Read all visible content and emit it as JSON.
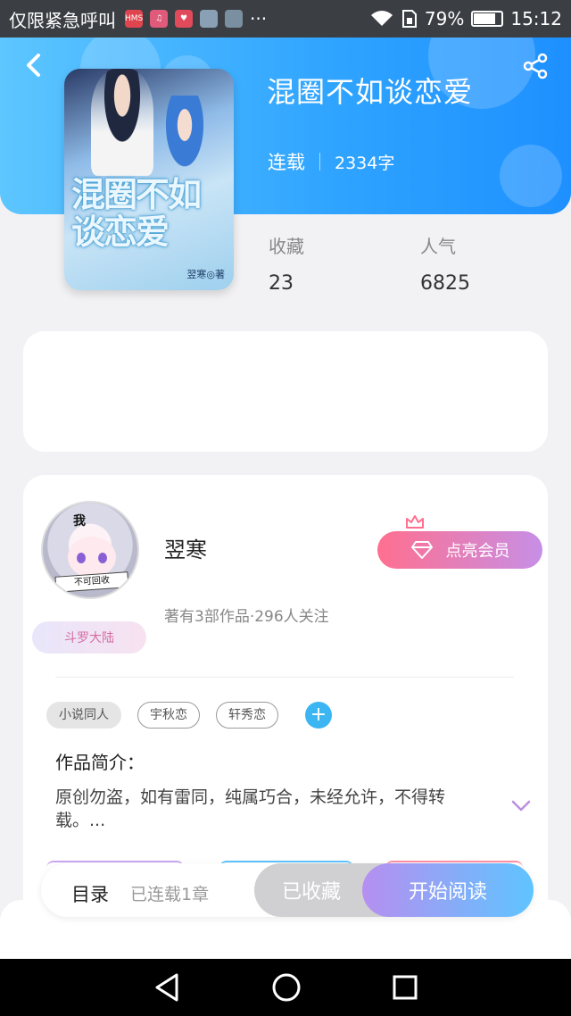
{
  "status_bar": {
    "carrier": "仅限紧急呼叫",
    "icons": [
      "hms-icon",
      "music-icon",
      "heart-icon",
      "photo-icon",
      "photo-icon",
      "more-dots-icon"
    ],
    "more": "···",
    "battery_percent": "79%",
    "battery_level": 0.79,
    "time": "15:12"
  },
  "book": {
    "title": "混圈不如谈恋爱",
    "status": "连载",
    "word_count": "2334字",
    "cover_title": "混圈不如谈恋爱",
    "cover_author": "翌寒◎著",
    "stats": [
      {
        "label": "收藏",
        "value": "23"
      },
      {
        "label": "人气",
        "value": "6825"
      }
    ]
  },
  "author": {
    "name": "翌寒",
    "info": "著有3部作品·296人关注",
    "badge": "斗罗大陆",
    "avatar_sign": "不可回收",
    "avatar_me": "我",
    "vip_button": "点亮会员"
  },
  "tags": [
    "小说同人",
    "宇秋恋",
    "轩秀恋"
  ],
  "intro": {
    "title": "作品简介：",
    "text": "原创勿盗，如有雷同，纯属巧合，未经允许，不得转载。..."
  },
  "bottom_bar": {
    "toc_label": "目录",
    "toc_count": "已连载1章",
    "collected_label": "已收藏",
    "read_label": "开始阅读"
  },
  "colors": {
    "header_start": "#5dc6ff",
    "header_end": "#1e90ff",
    "vip_start": "#ff6f8f",
    "vip_end": "#c78fe6",
    "read_start": "#b68ff0",
    "read_end": "#5fc4ff",
    "tag_add": "#3bb6f2"
  }
}
